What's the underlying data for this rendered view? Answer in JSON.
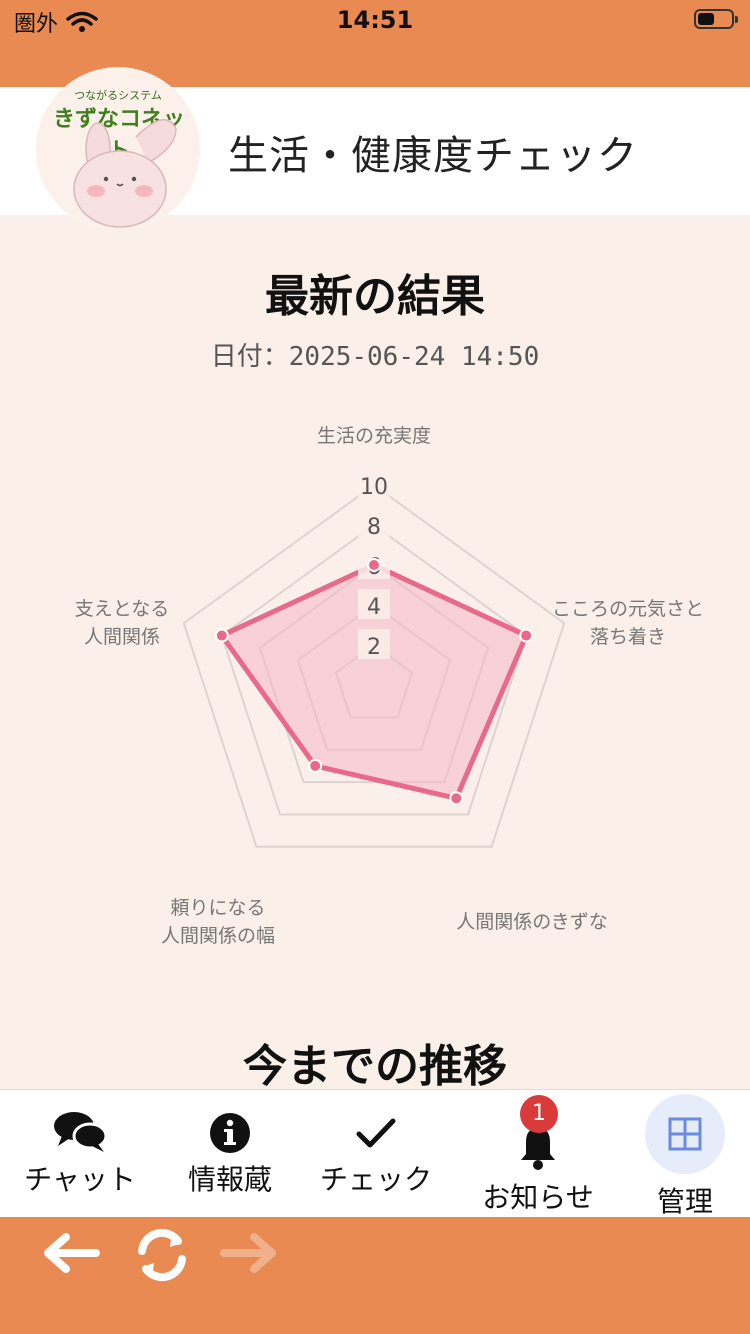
{
  "status_bar": {
    "carrier": "圏外",
    "time": "14:51"
  },
  "header": {
    "logo_subtitle": "つながるシステム",
    "logo_name": "きずなコネット",
    "title": "生活・健康度チェック"
  },
  "latest": {
    "title": "最新の結果",
    "date": "日付：2025-06-24 14:50"
  },
  "chart_data": {
    "type": "radar",
    "axes": [
      [
        "生活の充実度"
      ],
      [
        "こころの元気さと",
        "落ち着き"
      ],
      [
        "人間関係のきずな"
      ],
      [
        "頼りになる",
        "人間関係の幅"
      ],
      [
        "支えとなる",
        "人間関係"
      ]
    ],
    "values": [
      6,
      8,
      7,
      5,
      8
    ],
    "rlim": [
      0,
      10
    ],
    "ticks": [
      "2",
      "4",
      "6",
      "8",
      "10"
    ],
    "line_color": "#e8698a",
    "fill_color": "#f4b8c4",
    "grid": true
  },
  "history": {
    "title": "今までの推移"
  },
  "tabs": [
    {
      "label": "チャット",
      "icon": "chat-bubbles-icon"
    },
    {
      "label": "情報蔵",
      "icon": "info-icon"
    },
    {
      "label": "チェック",
      "icon": "checkmark-icon"
    },
    {
      "label": "お知らせ",
      "icon": "bell-icon",
      "badge": "1"
    },
    {
      "label": "管理",
      "icon": "grid-icon"
    }
  ],
  "colors": {
    "accent": "#e98a52",
    "background": "#fbefe9",
    "badge": "#d93b3b"
  }
}
